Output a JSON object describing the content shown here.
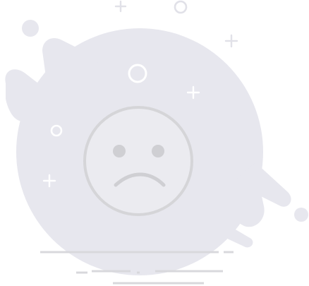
{
  "illustration": {
    "subject": "sad-face",
    "colors": {
      "blob": "#e7e7ee",
      "face_fill": "#ebebf0",
      "face_stroke": "#d5d5d8",
      "features": "#cfcfd3",
      "sparkle": "#e1e1e8",
      "sparkle_light": "#ffffff",
      "ground_lines": "#d8d8dc",
      "background": "#ffffff"
    }
  }
}
